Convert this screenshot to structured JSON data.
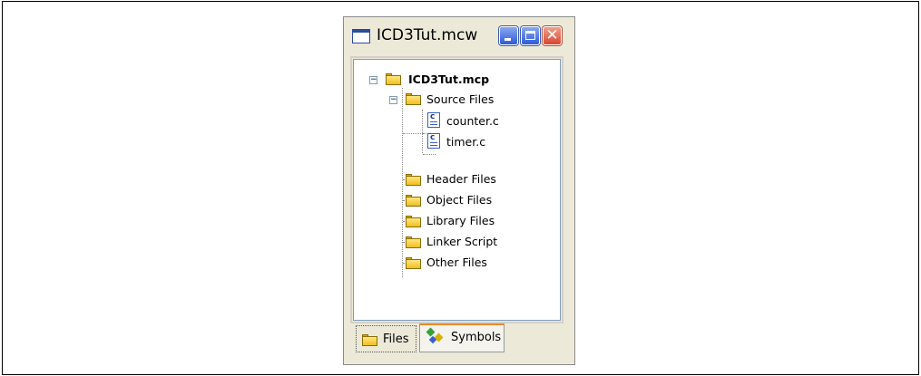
{
  "window": {
    "title": "ICD3Tut.mcw"
  },
  "tree": {
    "root": "ICD3Tut.mcp",
    "source_folder": "Source Files",
    "source_files": [
      "counter.c",
      "timer.c"
    ],
    "folders": [
      "Header Files",
      "Object Files",
      "Library Files",
      "Linker Script",
      "Other Files"
    ]
  },
  "tabs": {
    "files": "Files",
    "symbols": "Symbols"
  },
  "icons": {
    "window": "window-icon",
    "minimize": "minimize-icon",
    "maximize": "maximize-icon",
    "close": "close-icon",
    "folder": "folder-icon",
    "c_file": "c-source-file-icon",
    "symbols": "symbols-icon"
  },
  "colors": {
    "close_button": "#d8452f",
    "title_buttons": "#2f5ad8",
    "folder": "#f0c020",
    "active_tab_accent": "#e68b2c"
  }
}
